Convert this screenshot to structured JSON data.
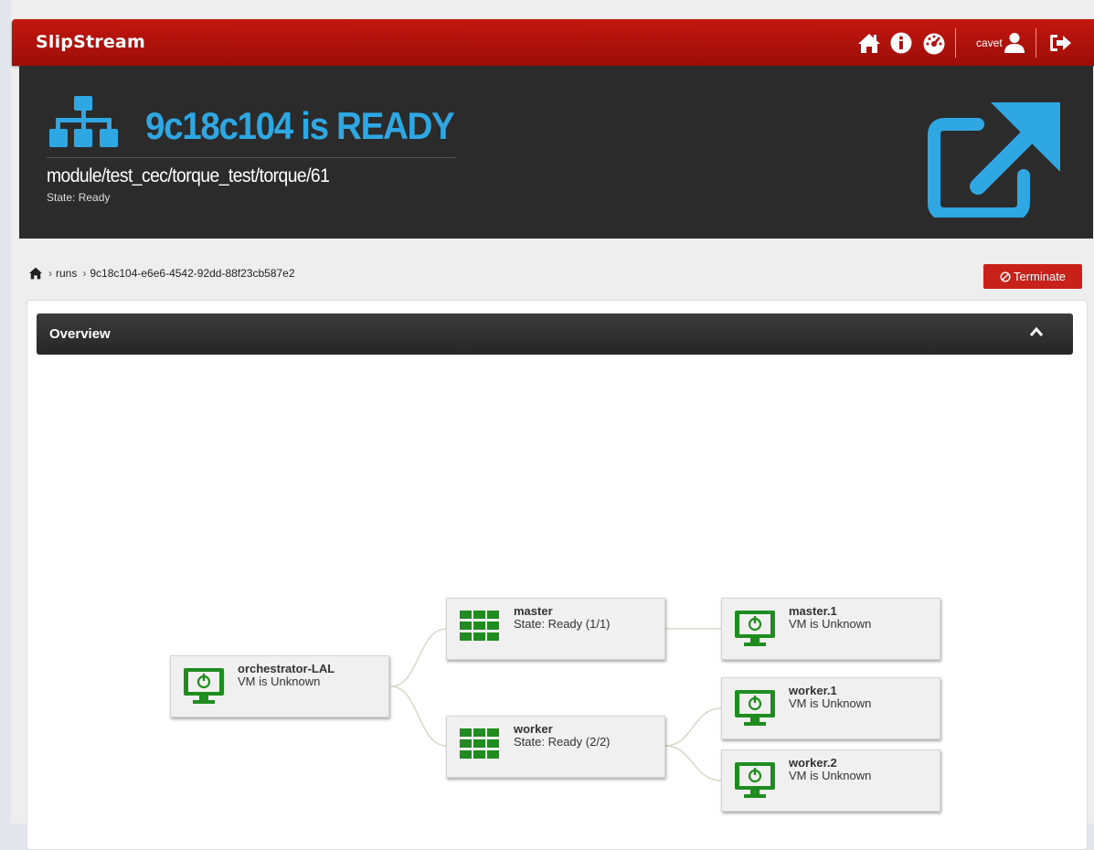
{
  "navbar": {
    "brand": "SlipStream",
    "username": "cavet",
    "icons": [
      "home-icon",
      "info-icon",
      "dashboard-icon",
      "user-icon",
      "logout-icon"
    ]
  },
  "hero": {
    "title": "9c18c104 is READY",
    "module": "module/test_cec/torque_test/torque/61",
    "state": "State: Ready"
  },
  "breadcrumb": {
    "items": [
      "runs",
      "9c18c104-e6e6-4542-92dd-88f23cb587e2"
    ]
  },
  "actions": {
    "terminate": "Terminate"
  },
  "overview": {
    "title": "Overview",
    "nodes": [
      {
        "name": "orchestrator-LAL",
        "status": "VM is Unknown",
        "kind": "vm"
      },
      {
        "name": "master",
        "status": "State: Ready (1/1)",
        "kind": "group"
      },
      {
        "name": "worker",
        "status": "State: Ready (2/2)",
        "kind": "group"
      },
      {
        "name": "master.1",
        "status": "VM is Unknown",
        "kind": "vm"
      },
      {
        "name": "worker.1",
        "status": "VM is Unknown",
        "kind": "vm"
      },
      {
        "name": "worker.2",
        "status": "VM is Unknown",
        "kind": "vm"
      }
    ]
  },
  "colors": {
    "navbar": "#b3120c",
    "accent": "#2fa7e2",
    "node_icon": "#1e8c1e",
    "terminate": "#c8211a"
  }
}
